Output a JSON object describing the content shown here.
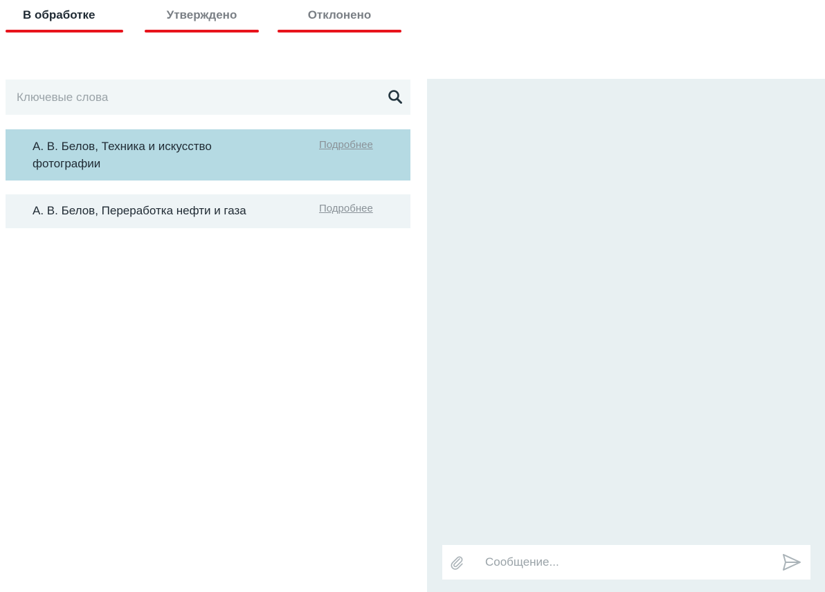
{
  "colors": {
    "tab_underline": "#e8141c",
    "selected_item_bg": "#b5dae3",
    "item_bg": "#eef4f6",
    "chat_bg": "#e8f0f2"
  },
  "tabs": [
    {
      "label": "В обработке",
      "active": true
    },
    {
      "label": "Утверждено",
      "active": false
    },
    {
      "label": "Отклонено",
      "active": false
    }
  ],
  "search": {
    "placeholder": "Ключевые слова",
    "value": "",
    "icon": "search-icon"
  },
  "requests": [
    {
      "title": "А. В. Белов, Техника и искусство фотографии",
      "more_label": "Подробнее",
      "selected": true
    },
    {
      "title": "А. В. Белов, Переработка нефти и газа",
      "more_label": "Подробнее",
      "selected": false
    }
  ],
  "chat": {
    "message_placeholder": "Сообщение...",
    "message_value": "",
    "attach_icon": "paperclip-icon",
    "send_icon": "send-icon"
  }
}
